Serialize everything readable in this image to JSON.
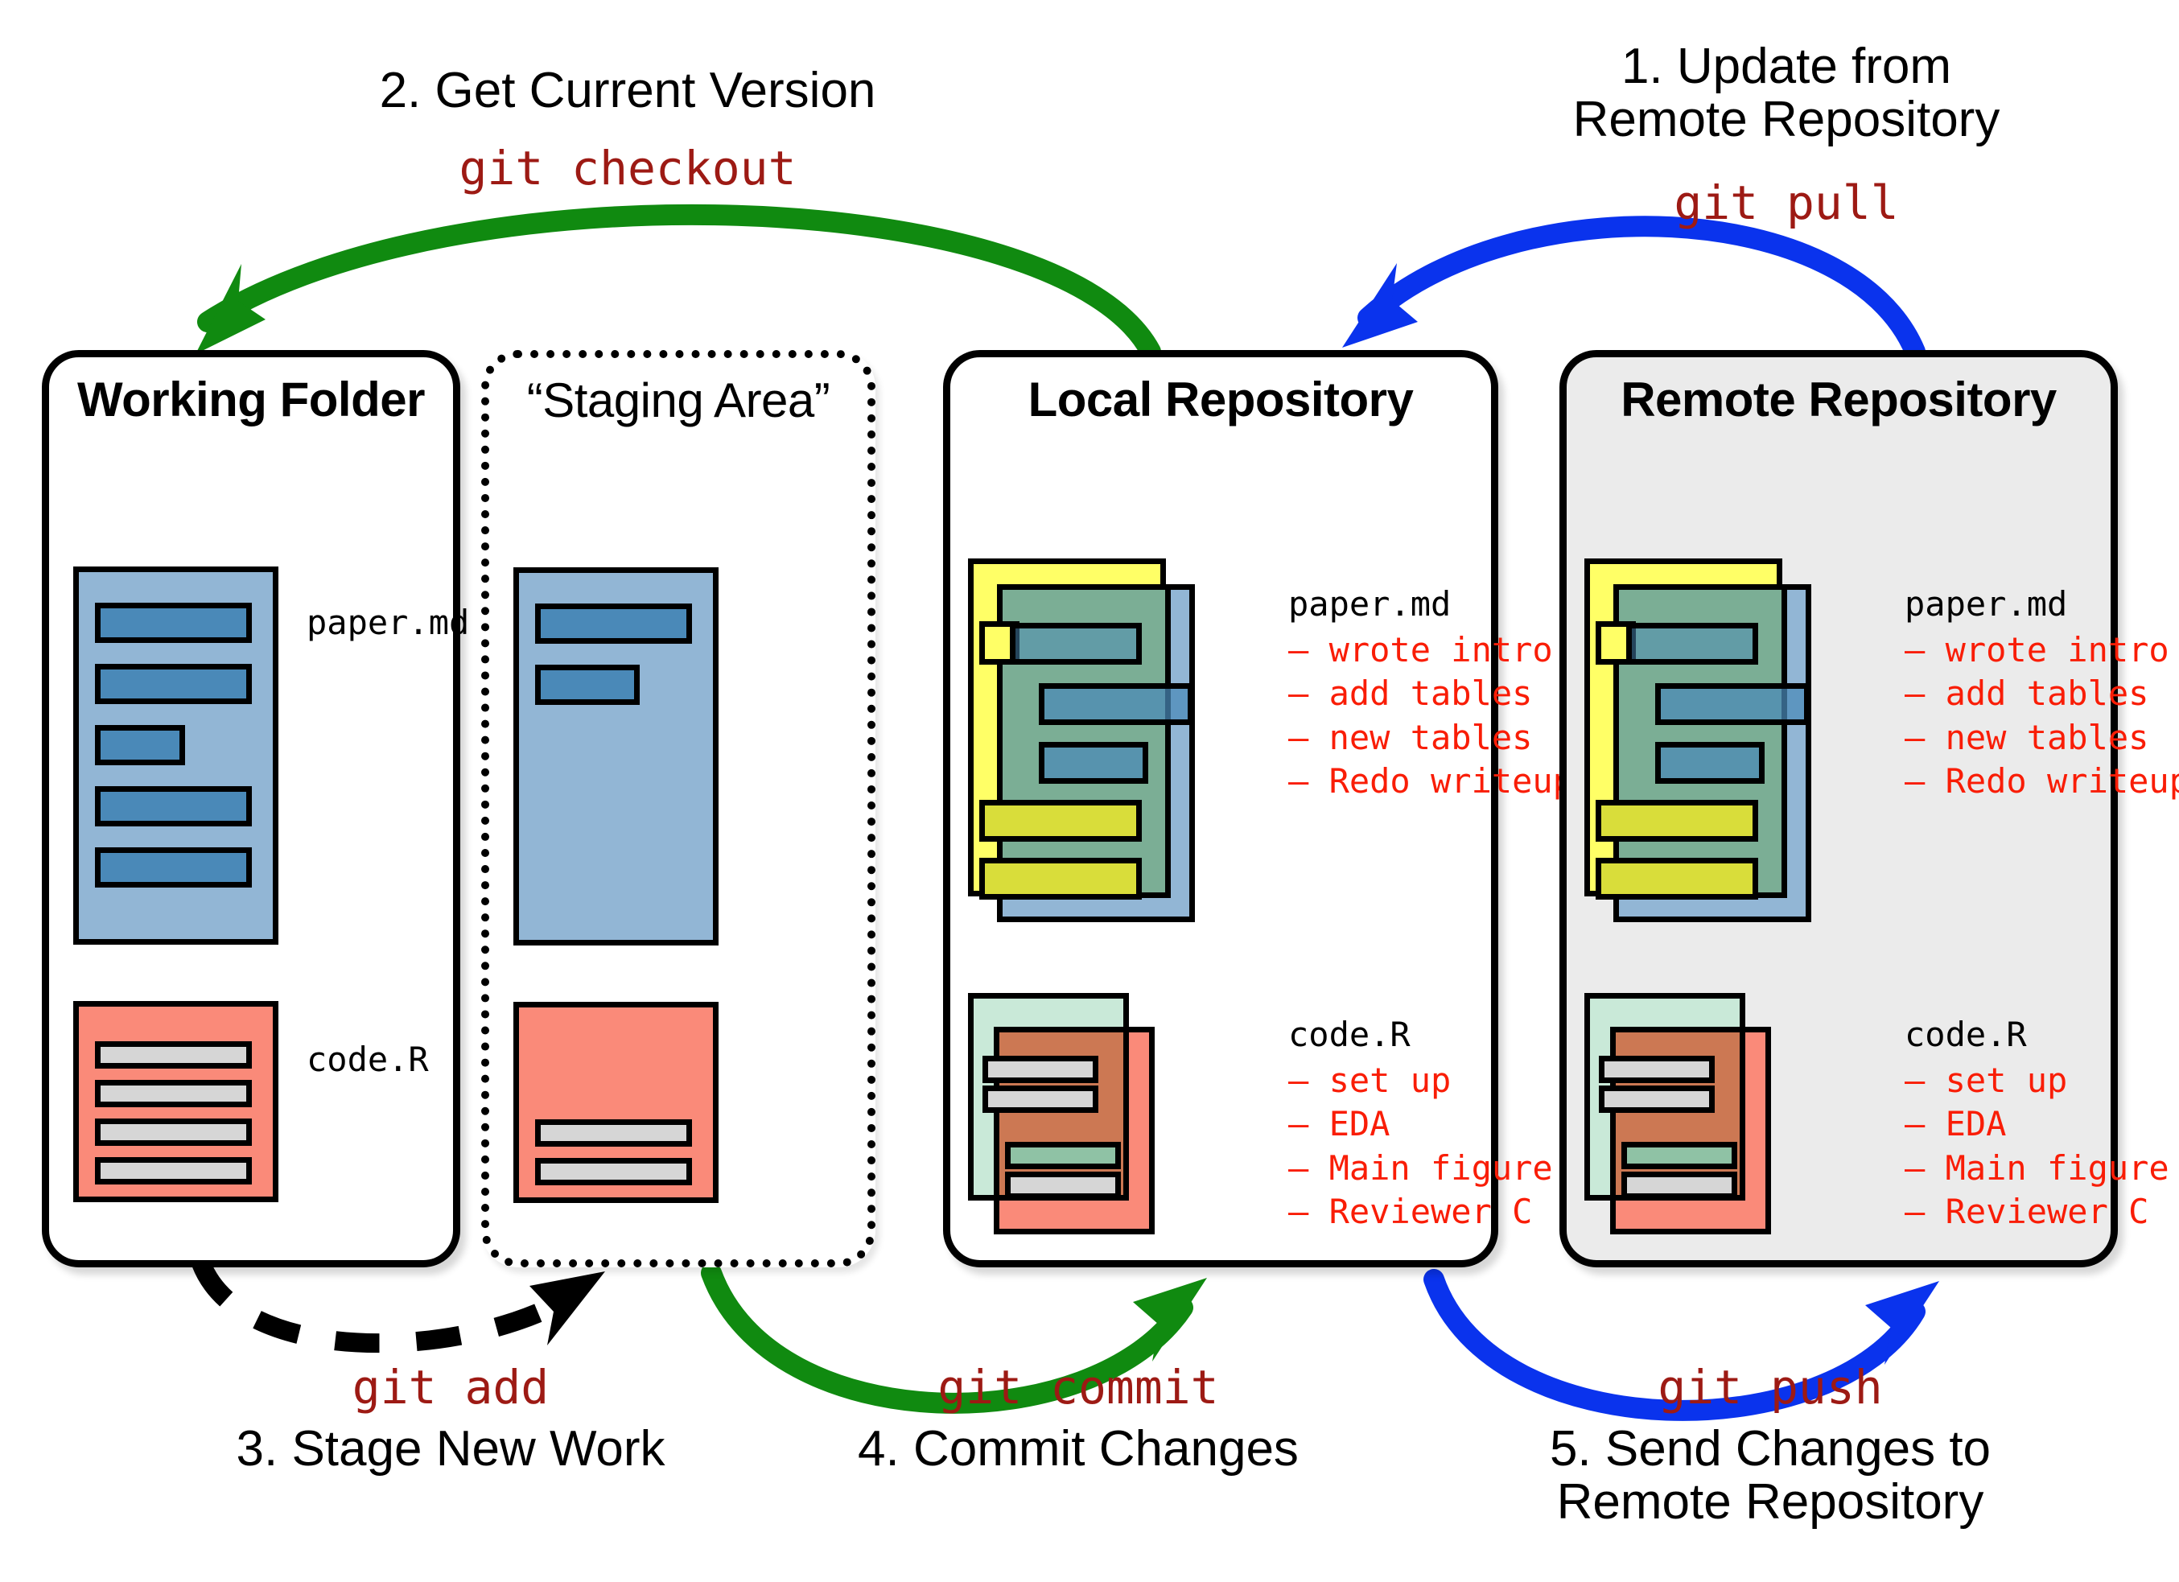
{
  "panels": [
    {
      "id": "working-folder",
      "title": "Working Folder",
      "style": "solid"
    },
    {
      "id": "staging-area",
      "title": "“Staging Area”",
      "style": "dotted"
    },
    {
      "id": "local-repository",
      "title": "Local Repository",
      "style": "solid"
    },
    {
      "id": "remote-repository",
      "title": "Remote Repository",
      "style": "gray"
    }
  ],
  "files": {
    "paper": "paper.md",
    "code": "code.R"
  },
  "paper_commits": [
    "– wrote intro",
    "– add tables",
    "– new tables",
    "– Redo writeup"
  ],
  "code_commits": [
    "– set up",
    "– EDA",
    "– Main figure",
    "– Reviewer C"
  ],
  "steps": {
    "pull": {
      "line1": "1. Update from",
      "line2": "Remote Repository",
      "command": "git pull",
      "color": "#0a33ed"
    },
    "checkout": {
      "line1": "2. Get Current Version",
      "line2": "",
      "command": "git checkout",
      "color": "#108a10"
    },
    "add": {
      "line1": "3. Stage New Work",
      "line2": "",
      "command": "git add",
      "color": "#000000"
    },
    "commit": {
      "line1": "4. Commit Changes",
      "line2": "",
      "command": "git commit",
      "color": "#108a10"
    },
    "push": {
      "line1": "5. Send Changes to",
      "line2": "Remote Repository",
      "command": "git push",
      "color": "#0a33ed"
    }
  },
  "colors": {
    "green_arrow": "#108a10",
    "blue_arrow": "#0a33ed",
    "black_arrow": "#000000",
    "command_text": "#9d1a14",
    "commit_text": "#f91d06",
    "card_blue": "#92b6d5",
    "card_blue_bar": "#4a89b8",
    "card_salmon": "#fa8a79",
    "card_gray_bar": "#d6d6d6",
    "card_yellow": "#ffff66",
    "card_green": "#6eaa6e",
    "card_mint": "#c9e9d8",
    "card_brown": "#b06e3c",
    "remote_bg": "#ebebeb"
  }
}
